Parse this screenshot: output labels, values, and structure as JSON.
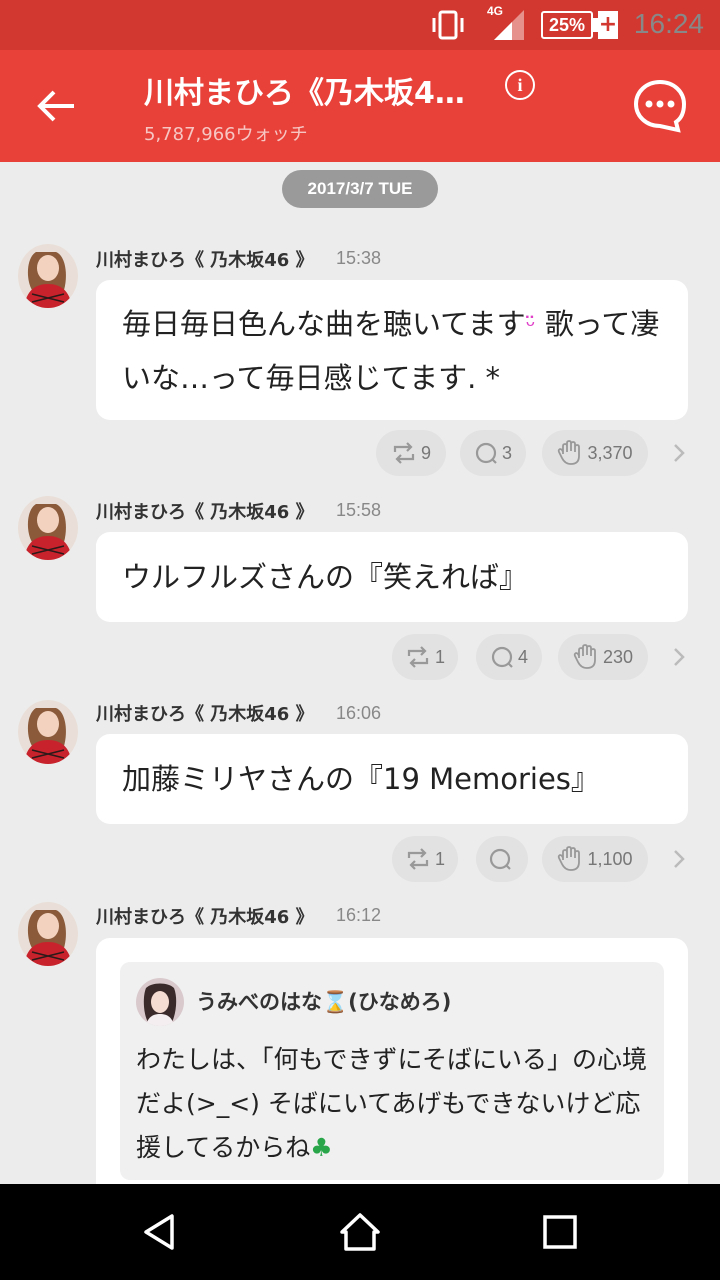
{
  "status_bar": {
    "time": "16:24",
    "battery": "25%",
    "network": "4G"
  },
  "app_bar": {
    "title": "川村まひろ《乃木坂4…",
    "subtitle": "5,787,966ウォッチ",
    "info_label": "i"
  },
  "date_pill": "2017/3/7 TUE",
  "posts": [
    {
      "author": "川村まひろ《 乃木坂46 》",
      "time": "15:38",
      "text_1": "毎日毎日色んな曲を聴いてます",
      "text_emoji": "😌",
      "text_2": " 歌って凄いな…って毎日感じてます. *",
      "retweets": "9",
      "comments": "3",
      "claps": "3,370"
    },
    {
      "author": "川村まひろ《 乃木坂46 》",
      "time": "15:58",
      "text": "ウルフルズさんの『笑えれば』",
      "retweets": "1",
      "comments": "4",
      "claps": "230"
    },
    {
      "author": "川村まひろ《 乃木坂46 》",
      "time": "16:06",
      "text": "加藤ミリヤさんの『19 Memories』",
      "retweets": "1",
      "comments": "",
      "claps": "1,100"
    },
    {
      "author": "川村まひろ《 乃木坂46 》",
      "time": "16:12"
    }
  ],
  "quote": {
    "author_1": "うみべのはな",
    "author_2": "(ひなめろ)",
    "text": "わたしは、「何もできずにそばにいる」の心境だよ(>_<) そばにいてあげもできないけど応援してるからね"
  },
  "colors": {
    "accent": "#e8413a",
    "status_bar": "#d2382f"
  }
}
